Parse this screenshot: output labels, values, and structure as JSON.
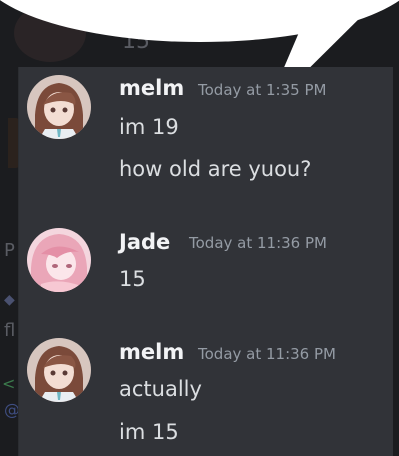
{
  "background_chat": {
    "partial_text_1": "15",
    "partial_text_2": "P",
    "partial_text_3": "fl",
    "partial_text_4": "@",
    "partial_text_5": "<"
  },
  "messages": [
    {
      "author": "melm",
      "timestamp": "Today at 1:35 PM",
      "lines": [
        "im 19",
        "how old are yuou?"
      ]
    },
    {
      "author": "Jade",
      "timestamp": "Today at 11:36 PM",
      "lines": [
        "15"
      ]
    },
    {
      "author": "melm",
      "timestamp": "Today at 11:36 PM",
      "lines": [
        "actually",
        "im 15"
      ]
    }
  ],
  "colors": {
    "panel_bg": "#313338",
    "name": "#f2f3f5",
    "text": "#dbdee1",
    "timestamp": "#949ba4",
    "bubble": "#ffffff"
  }
}
